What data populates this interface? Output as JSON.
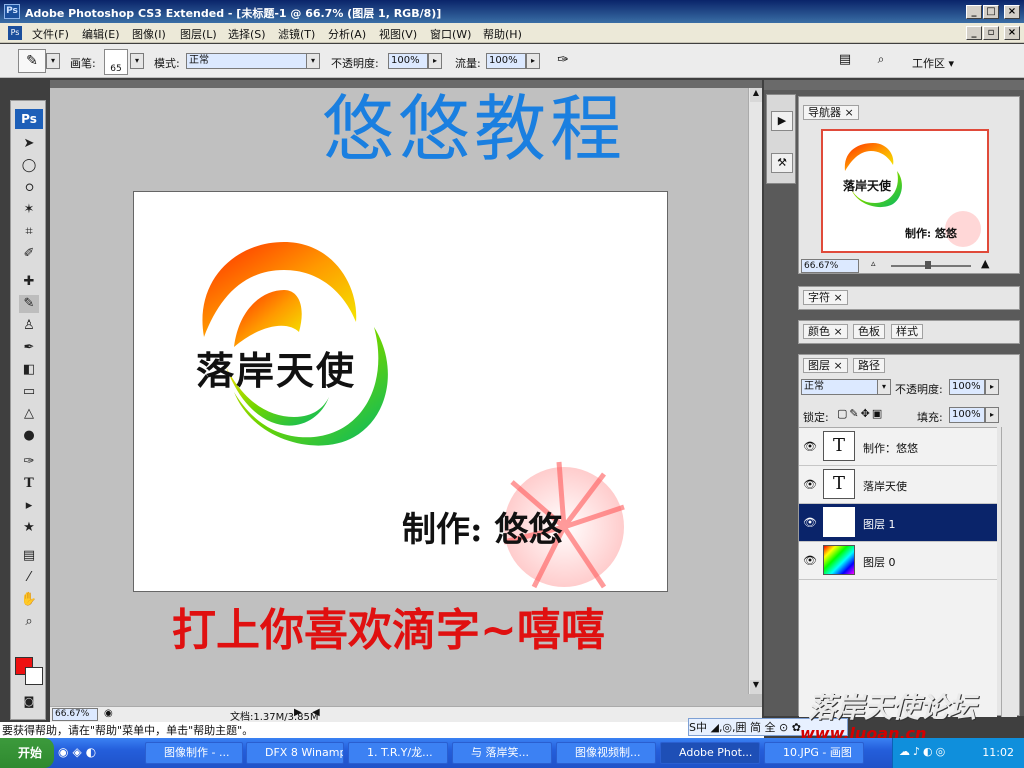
{
  "window": {
    "badge": "Ps",
    "title": "Adobe Photoshop CS3 Extended - [未标题-1 @ 66.7% (图层 1, RGB/8)]"
  },
  "menu": [
    "文件(F)",
    "编辑(E)",
    "图像(I)",
    "图层(L)",
    "选择(S)",
    "滤镜(T)",
    "分析(A)",
    "视图(V)",
    "窗口(W)",
    "帮助(H)"
  ],
  "options": {
    "brush_label": "画笔:",
    "brush_size": "65",
    "mode_label": "模式:",
    "mode_value": "正常",
    "opacity_label": "不透明度:",
    "opacity_value": "100%",
    "flow_label": "流量:",
    "flow_value": "100%",
    "workspace_label": "工作区 ▾"
  },
  "overlay_text": {
    "title": "悠悠教程",
    "bottom": "打上你喜欢滴字~嘻嘻",
    "site": "www.luoan.cn",
    "forum": "落岸天使论坛"
  },
  "canvas": {
    "logo_text": "落岸天使",
    "credit": "制作:  悠悠"
  },
  "navigator": {
    "tab": "导航器",
    "zoom": "66.67%",
    "thumb_text": "落岸天使",
    "thumb_credit": "制作: 悠悠"
  },
  "char_panel": {
    "tab": "字符"
  },
  "color_panel": {
    "tabs": [
      "颜色",
      "色板",
      "样式"
    ]
  },
  "layers_panel": {
    "tabs": [
      "图层",
      "路径"
    ],
    "blend_mode": "正常",
    "opacity_label": "不透明度:",
    "opacity_value": "100%",
    "lock_label": "锁定:",
    "fill_label": "填充:",
    "fill_value": "100%",
    "layers": [
      {
        "name": "制作：悠悠",
        "thumb": "T",
        "selected": false
      },
      {
        "name": "落岸天使",
        "thumb": "T",
        "selected": false
      },
      {
        "name": "图层 1",
        "thumb": "",
        "selected": true
      },
      {
        "name": "图层 0",
        "thumb": "",
        "selected": false
      }
    ]
  },
  "statusbar": {
    "zoom": "66.67%",
    "doc_info": "文档:1.37M/3.85M"
  },
  "hint": "要获得帮助，请在\"帮助\"菜单中，单击\"帮助主题\"。",
  "ime": "S中 ◢,◎,囲 简 全 ⊙ ✿",
  "taskbar": {
    "start": "开始",
    "tasks": [
      "图像制作 - ...",
      "DFX 8 Winamp",
      "1. T.R.Y/龙...",
      "与 落岸笑...",
      "图像视频制...",
      "Adobe Phot...",
      "10.JPG - 画图"
    ],
    "clock": "11:02"
  },
  "colors": {
    "foreground": "#ee1111",
    "background": "#ffffff",
    "title_overlay": "#1a7fe0",
    "bottom_overlay": "#e01010"
  }
}
